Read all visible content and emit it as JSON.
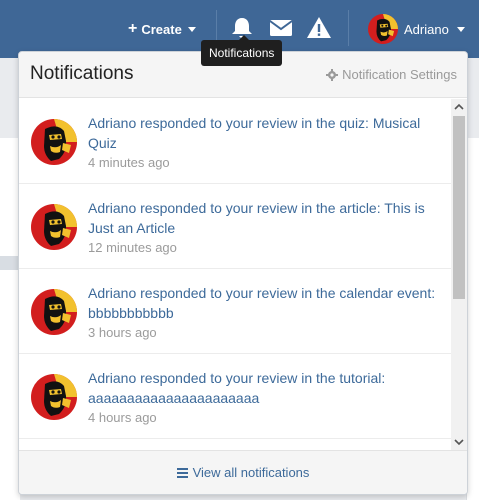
{
  "navbar": {
    "create_label": "Create",
    "user_name": "Adriano"
  },
  "tooltip": {
    "text": "Notifications"
  },
  "panel": {
    "title": "Notifications",
    "settings_label": "Notification Settings",
    "footer_label": "View all notifications"
  },
  "notifications": [
    {
      "text": "Adriano responded to your review in the quiz: Musical Quiz",
      "time": "4 minutes ago"
    },
    {
      "text": "Adriano responded to your review in the article: This is Just an Article",
      "time": "12 minutes ago"
    },
    {
      "text": "Adriano responded to your review in the calendar event: bbbbbbbbbbb",
      "time": "3 hours ago"
    },
    {
      "text": "Adriano responded to your review in the tutorial: aaaaaaaaaaaaaaaaaaaaaa",
      "time": "4 hours ago"
    }
  ],
  "colors": {
    "navbar": "#3f6796",
    "link": "#3d6a9a",
    "muted": "#9b9b9b"
  }
}
